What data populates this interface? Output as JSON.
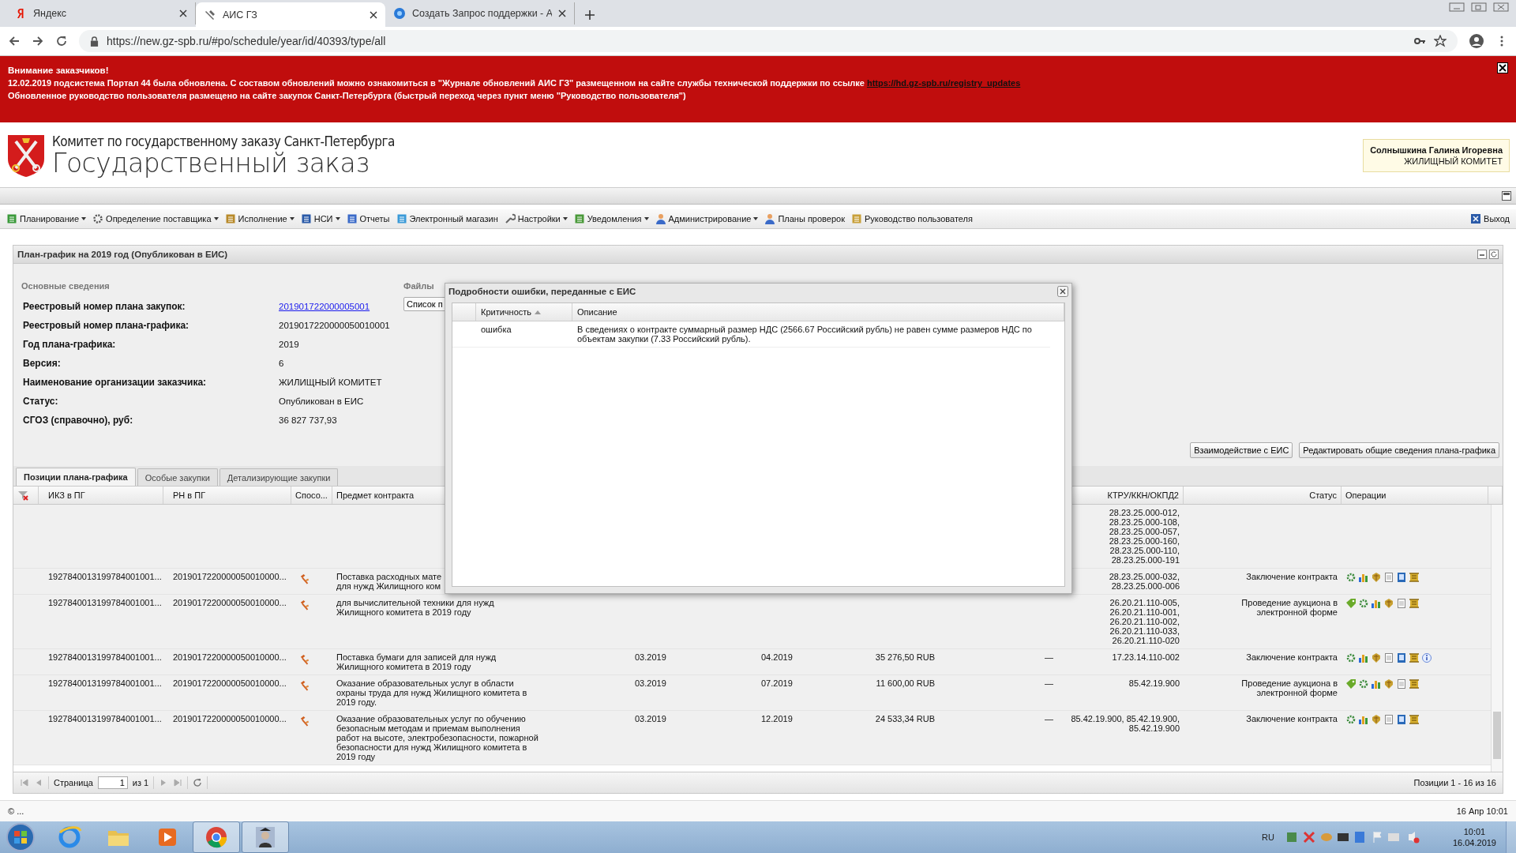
{
  "browser": {
    "tabs": [
      {
        "title": "Яндекс",
        "selected": false
      },
      {
        "title": "АИС ГЗ",
        "selected": true
      },
      {
        "title": "Создать Запрос поддержки - А",
        "selected": false
      }
    ],
    "url": "https://new.gz-spb.ru/#po/schedule/year/id/40393/type/all"
  },
  "banner": {
    "title": "Внимание заказчиков!",
    "line1": "12.02.2019 подсистема Портал 44 была обновлена. С составом обновлений можно ознакомиться в \"Журнале обновлений АИС ГЗ\" размещенном на сайте службы технической поддержки по ссылке",
    "link": "https://hd.gz-spb.ru/registry_updates",
    "line2": "Обновленное руководство пользователя размещено на сайте закупок Санкт-Петербурга (быстрый переход через пункт меню \"Руководство пользователя\")"
  },
  "header": {
    "subtitle": "Комитет по государственному заказу Санкт-Петербурга",
    "title": "Государственный заказ",
    "user": "Солнышкина Галина Игоревна",
    "org": "ЖИЛИЩНЫЙ КОМИТЕТ"
  },
  "menu": [
    {
      "label": "Планирование",
      "dropdown": true
    },
    {
      "label": "Определение поставщика",
      "dropdown": true
    },
    {
      "label": "Исполнение",
      "dropdown": true
    },
    {
      "label": "НСИ",
      "dropdown": true
    },
    {
      "label": "Отчеты",
      "dropdown": false
    },
    {
      "label": "Электронный магазин",
      "dropdown": false
    },
    {
      "label": "Настройки",
      "dropdown": true
    },
    {
      "label": "Уведомления",
      "dropdown": true
    },
    {
      "label": "Администрирование",
      "dropdown": true
    },
    {
      "label": "Планы проверок",
      "dropdown": false
    },
    {
      "label": "Руководство пользователя",
      "dropdown": false
    }
  ],
  "logout": "Выход",
  "panel": {
    "title": "План-график на 2019 год (Опубликован в ЕИС)",
    "section": "Основные сведения",
    "fields": [
      {
        "label": "Реестровый номер плана закупок:",
        "value": "201901722000005001",
        "kind": "link"
      },
      {
        "label": "Реестровый номер плана-графика:",
        "value": "2019017220000050010001",
        "kind": "text"
      },
      {
        "label": "Год плана-графика:",
        "value": "2019",
        "kind": "text"
      },
      {
        "label": "Версия:",
        "value": "6",
        "kind": "text"
      },
      {
        "label": "Наименование организации заказчика:",
        "value": "ЖИЛИЩНЫЙ КОМИТЕТ",
        "kind": "text"
      },
      {
        "label": "Статус:",
        "value": "Опубликован в ЕИС",
        "kind": "text"
      },
      {
        "label": "СГОЗ (справочно), руб:",
        "value": "36 827 737,93",
        "kind": "text"
      }
    ],
    "files_title": "Файлы",
    "files_button": "Список п",
    "actions": [
      "Взаимодействие с ЕИС",
      "Редактировать общие сведения плана-графика"
    ]
  },
  "tabs": [
    {
      "label": "Позиции плана-графика",
      "selected": true
    },
    {
      "label": "Особые закупки",
      "selected": false
    },
    {
      "label": "Детализирующие закупки",
      "selected": false
    }
  ],
  "table": {
    "columns": {
      "ikz": "ИКЗ в ПГ",
      "rn": "РН в ПГ",
      "method": "Спосо...",
      "subject": "Предмет контракта",
      "ktru": "КТРУ/ККН/ОКПД2",
      "status": "Статус",
      "ops": "Операции"
    },
    "rows": [
      {
        "ikz": "",
        "rn": "",
        "method": false,
        "subject": [],
        "start": "",
        "end": "",
        "sum": "",
        "dash": "",
        "ktru": [
          "28.23.25.000-012,",
          "28.23.25.000-108,",
          "28.23.25.000-057,",
          "28.23.25.000-160,",
          "28.23.25.000-110,",
          "28.23.25.000-191"
        ],
        "status": "",
        "kind": "codes_only",
        "info": false
      },
      {
        "ikz": "1927840013199784001001...",
        "rn": "2019017220000050010000...",
        "method": true,
        "subject": [
          "Поставка расходных мате",
          "для нужд Жилищного ком"
        ],
        "start": "",
        "end": "",
        "sum": "",
        "dash": "",
        "ktru": [
          "28.23.25.000-032,",
          "28.23.25.000-006"
        ],
        "status": "Заключение контракта",
        "kind": "contract",
        "info": false
      },
      {
        "ikz": "1927840013199784001001...",
        "rn": "2019017220000050010000...",
        "method": true,
        "subject": [
          "для вычислительной техники для нужд",
          "Жилищного комитета в 2019 году"
        ],
        "start": "",
        "end": "",
        "sum": "",
        "dash": "",
        "ktru": [
          "26.20.21.110-005,",
          "26.20.21.110-001,",
          "26.20.21.110-002,",
          "26.20.21.110-033,",
          "26.20.21.110-020"
        ],
        "status": "Проведение аукциона в электронной форме",
        "kind": "auction",
        "info": false
      },
      {
        "ikz": "1927840013199784001001...",
        "rn": "2019017220000050010000...",
        "method": true,
        "subject": [
          "Поставка бумаги для записей для нужд",
          "Жилищного комитета в 2019 году"
        ],
        "start": "03.2019",
        "end": "04.2019",
        "sum": "35 276,50 RUB",
        "dash": "—",
        "ktru": [
          "17.23.14.110-002"
        ],
        "status": "Заключение контракта",
        "kind": "contract",
        "info": true
      },
      {
        "ikz": "1927840013199784001001...",
        "rn": "2019017220000050010000...",
        "method": true,
        "subject": [
          "Оказание образовательных услуг в области",
          "охраны труда для нужд Жилищного комитета в",
          "2019 году."
        ],
        "start": "03.2019",
        "end": "07.2019",
        "sum": "11 600,00 RUB",
        "dash": "—",
        "ktru": [
          "85.42.19.900"
        ],
        "status": "Проведение аукциона в электронной форме",
        "kind": "auction",
        "info": false
      },
      {
        "ikz": "1927840013199784001001...",
        "rn": "2019017220000050010000...",
        "method": true,
        "subject": [
          "Оказание образовательных услуг по обучению",
          "безопасным методам и приемам выполнения",
          "работ на высоте, электробезопасности, пожарной",
          "безопасности для нужд Жилищного комитета в",
          "2019 году"
        ],
        "start": "03.2019",
        "end": "12.2019",
        "sum": "24 533,34 RUB",
        "dash": "—",
        "ktru": [
          "85.42.19.900, 85.42.19.900,",
          "85.42.19.900"
        ],
        "status": "Заключение контракта",
        "kind": "contract",
        "info": false
      }
    ]
  },
  "pager": {
    "page_label": "Страница",
    "page": "1",
    "of": "из 1",
    "summary": "Позиции 1 - 16 из 16"
  },
  "status_bar": {
    "left": "© ...",
    "right": "16 Апр 10:01"
  },
  "dialog": {
    "title": "Подробности ошибки, переданные с ЕИС",
    "columns": [
      "Критичность",
      "Описание"
    ],
    "rows": [
      {
        "severity": "ошибка",
        "description": "В сведениях о контракте суммарный размер НДС (2566.67 Российский рубль) не равен сумме размеров НДС по объектам закупки (7.33 Российский рубль)."
      }
    ]
  },
  "taskbar": {
    "apps": [
      {
        "active": false
      },
      {
        "active": false
      },
      {
        "active": false
      },
      {
        "active": true
      },
      {
        "active": true
      }
    ],
    "lang": "RU",
    "time": "10:01",
    "date": "16.04.2019"
  }
}
